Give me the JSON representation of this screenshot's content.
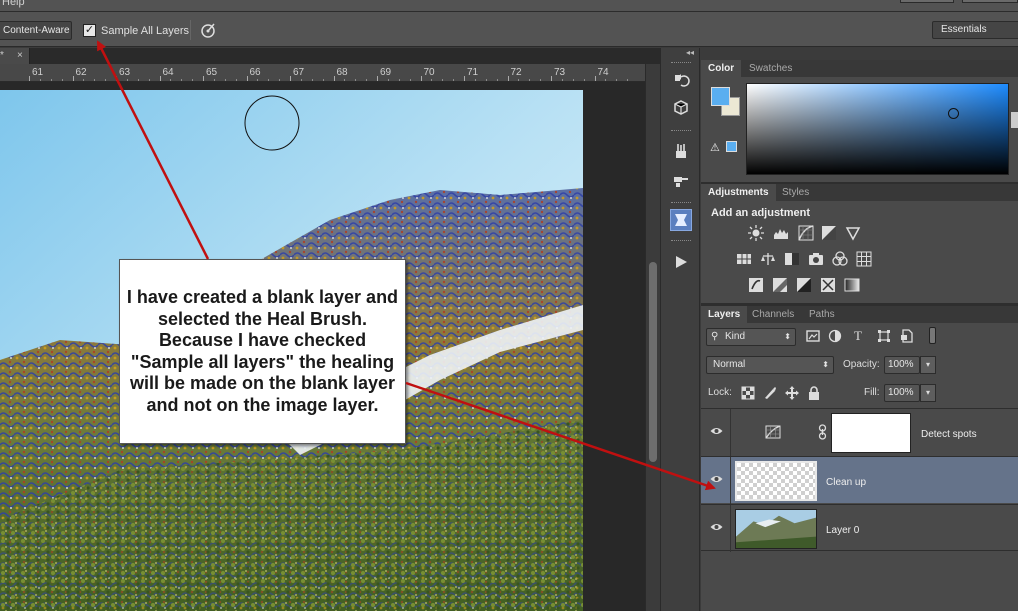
{
  "menu": {
    "help_label": "Help"
  },
  "options_bar": {
    "mode_value": "Content-Aware",
    "sample_all_layers_label": "Sample All Layers",
    "sample_all_layers_checked": true,
    "workspace_value": "Essentials"
  },
  "document": {
    "tab_modified_mark": "*",
    "tab_close": "×",
    "ruler_labels": [
      "61",
      "62",
      "63",
      "64",
      "65",
      "66",
      "67",
      "68",
      "69",
      "70",
      "71",
      "72",
      "73",
      "74"
    ]
  },
  "tools": {
    "icons": [
      "history-icon",
      "3d-icon",
      "brush-presets-icon",
      "clone-source-icon",
      "properties-icon",
      "play-actions-icon"
    ]
  },
  "color_panel": {
    "tabs": [
      "Color",
      "Swatches"
    ],
    "foreground_color": "#5aaef0",
    "background_color": "#ece8d4"
  },
  "adjustments_panel": {
    "tabs": [
      "Adjustments",
      "Styles"
    ],
    "title": "Add an adjustment"
  },
  "layers_panel": {
    "tabs": [
      "Layers",
      "Channels",
      "Paths"
    ],
    "filter_value": "Kind",
    "blend_mode": "Normal",
    "opacity_label": "Opacity:",
    "opacity_value": "100%",
    "lock_label": "Lock:",
    "fill_label": "Fill:",
    "fill_value": "100%",
    "layers": [
      {
        "name": "Detect spots",
        "type": "adjustment",
        "visible": true,
        "selected": false
      },
      {
        "name": "Clean up",
        "type": "pixel",
        "visible": true,
        "selected": true
      },
      {
        "name": "Layer 0",
        "type": "image",
        "visible": true,
        "selected": false
      }
    ]
  },
  "annotation": {
    "text": "I have created a blank layer and selected the Heal Brush. Because I have checked \"Sample all layers\" the healing will be made on the blank layer and not on the image layer.",
    "arrow_color": "#c01010"
  }
}
